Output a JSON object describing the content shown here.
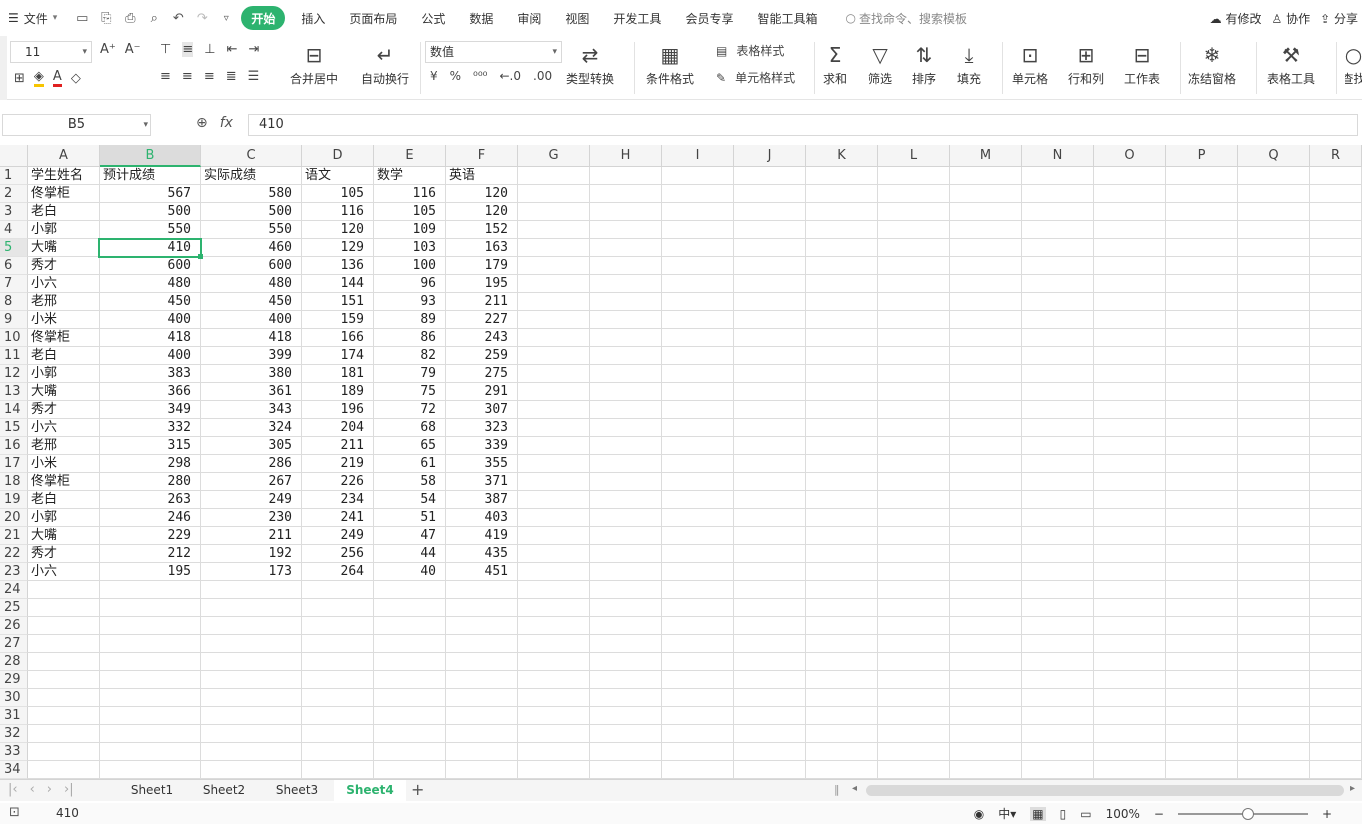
{
  "menubar": {
    "file_label": "文件",
    "tabs": [
      "开始",
      "插入",
      "页面布局",
      "公式",
      "数据",
      "审阅",
      "视图",
      "开发工具",
      "会员专享",
      "智能工具箱"
    ],
    "search_placeholder": "查找命令、搜索模板",
    "modified_label": "有修改",
    "collab_label": "协作",
    "share_label": "分享"
  },
  "ribbon": {
    "font_size": "11",
    "number_format": "数值",
    "merge_center": "合并居中",
    "wrap_text": "自动换行",
    "type_convert": "类型转换",
    "conditional_format": "条件格式",
    "table_style": "表格样式",
    "cell_style": "单元格样式",
    "sum": "求和",
    "filter": "筛选",
    "sort": "排序",
    "fill": "填充",
    "cell": "单元格",
    "row_col": "行和列",
    "worksheet": "工作表",
    "freeze_panes": "冻结窗格",
    "table_tools": "表格工具",
    "find": "查找"
  },
  "formula_bar": {
    "cell_ref": "B5",
    "value": "410"
  },
  "grid": {
    "columns": [
      "A",
      "B",
      "C",
      "D",
      "E",
      "F",
      "G",
      "H",
      "I",
      "J",
      "K",
      "L",
      "M",
      "N",
      "O",
      "P",
      "Q",
      "R"
    ],
    "headers": [
      "学生姓名",
      "预计成绩",
      "实际成绩",
      "语文",
      "数学",
      "英语"
    ],
    "rows": [
      [
        "佟掌柜",
        "567",
        "580",
        "105",
        "116",
        "120"
      ],
      [
        "老白",
        "500",
        "500",
        "116",
        "105",
        "120"
      ],
      [
        "小郭",
        "550",
        "550",
        "120",
        "109",
        "152"
      ],
      [
        "大嘴",
        "410",
        "460",
        "129",
        "103",
        "163"
      ],
      [
        "秀才",
        "600",
        "600",
        "136",
        "100",
        "179"
      ],
      [
        "小六",
        "480",
        "480",
        "144",
        "96",
        "195"
      ],
      [
        "老邢",
        "450",
        "450",
        "151",
        "93",
        "211"
      ],
      [
        "小米",
        "400",
        "400",
        "159",
        "89",
        "227"
      ],
      [
        "佟掌柜",
        "418",
        "418",
        "166",
        "86",
        "243"
      ],
      [
        "老白",
        "400",
        "399",
        "174",
        "82",
        "259"
      ],
      [
        "小郭",
        "383",
        "380",
        "181",
        "79",
        "275"
      ],
      [
        "大嘴",
        "366",
        "361",
        "189",
        "75",
        "291"
      ],
      [
        "秀才",
        "349",
        "343",
        "196",
        "72",
        "307"
      ],
      [
        "小六",
        "332",
        "324",
        "204",
        "68",
        "323"
      ],
      [
        "老邢",
        "315",
        "305",
        "211",
        "65",
        "339"
      ],
      [
        "小米",
        "298",
        "286",
        "219",
        "61",
        "355"
      ],
      [
        "佟掌柜",
        "280",
        "267",
        "226",
        "58",
        "371"
      ],
      [
        "老白",
        "263",
        "249",
        "234",
        "54",
        "387"
      ],
      [
        "小郭",
        "246",
        "230",
        "241",
        "51",
        "403"
      ],
      [
        "大嘴",
        "229",
        "211",
        "249",
        "47",
        "419"
      ],
      [
        "秀才",
        "212",
        "192",
        "256",
        "44",
        "435"
      ],
      [
        "小六",
        "195",
        "173",
        "264",
        "40",
        "451"
      ]
    ],
    "row_count": 34,
    "selected_col": "B",
    "selected_row": 5
  },
  "sheets": {
    "tabs": [
      "Sheet1",
      "Sheet2",
      "Sheet3",
      "Sheet4"
    ],
    "active": "Sheet4"
  },
  "status": {
    "value": "410",
    "zoom": "100%"
  },
  "colors": {
    "accent": "#2db36f"
  }
}
